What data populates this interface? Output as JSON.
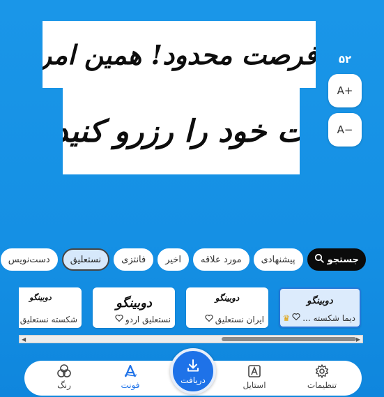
{
  "preview": {
    "line1": "*\"فرصت محدود! همین امروز",
    "line2": "نوبت خود را رزرو کنید\"*"
  },
  "font_size": {
    "value": "۵۲",
    "increase_label": "A+",
    "decrease_label": "A−"
  },
  "categories": {
    "search_label": "جستجو",
    "items": [
      {
        "label": "پیشنهادی"
      },
      {
        "label": "مورد علاقه"
      },
      {
        "label": "اخیر"
      },
      {
        "label": "فانتزی"
      },
      {
        "label": "نستعلیق",
        "selected": true
      },
      {
        "label": "دست‌نویس"
      }
    ]
  },
  "font_cards": [
    {
      "sample": "دوبینگو",
      "name": "دیما شکسته ...",
      "selected": true,
      "premium": true
    },
    {
      "sample": "دوبینگو",
      "name": "ایران نستعلیق"
    },
    {
      "sample": "دوبینگو",
      "name": "نستعلیق اردو"
    },
    {
      "sample": "دوبینگو",
      "name": "شکسته نستعلیق"
    }
  ],
  "nav": {
    "settings": "تنظیمات",
    "style": "استایل",
    "download": "دریافت",
    "font": "فونت",
    "colors": "رنگ"
  },
  "colors": {
    "background": "#1a96e8",
    "accent": "#1e72e8",
    "premium": "#e0a10a"
  }
}
